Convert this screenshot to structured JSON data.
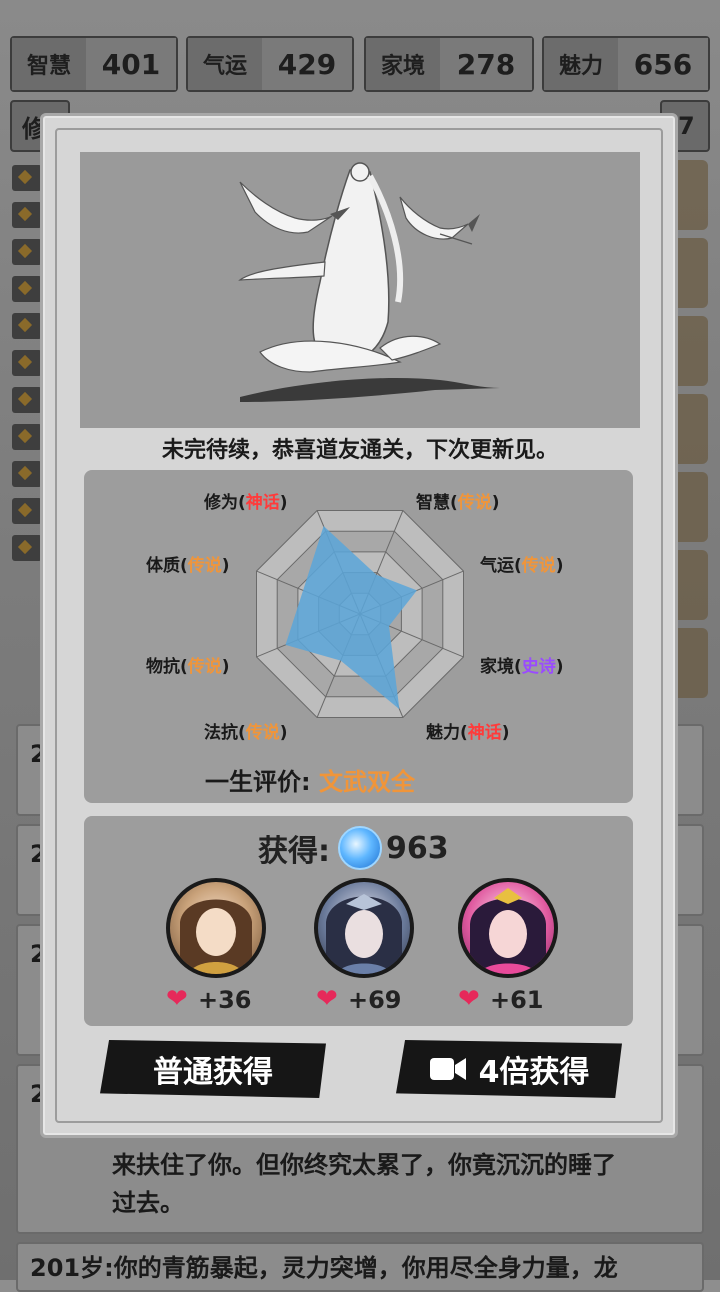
{
  "stats": [
    {
      "name": "智慧",
      "value": "401"
    },
    {
      "name": "气运",
      "value": "429"
    },
    {
      "name": "家境",
      "value": "278"
    },
    {
      "name": "魅力",
      "value": "656"
    }
  ],
  "stats_row2": {
    "left_partial": "修",
    "right_partial": "7"
  },
  "modal": {
    "caption": "未完待续，恭喜道友通关，下次更新见。",
    "radar": {
      "labels": [
        {
          "attr": "修为",
          "tier": "神话",
          "tier_class": "myth"
        },
        {
          "attr": "智慧",
          "tier": "传说",
          "tier_class": "legend"
        },
        {
          "attr": "气运",
          "tier": "传说",
          "tier_class": "legend"
        },
        {
          "attr": "家境",
          "tier": "史诗",
          "tier_class": "epic"
        },
        {
          "attr": "魅力",
          "tier": "神话",
          "tier_class": "myth"
        },
        {
          "attr": "法抗",
          "tier": "传说",
          "tier_class": "legend"
        },
        {
          "attr": "物抗",
          "tier": "传说",
          "tier_class": "legend"
        },
        {
          "attr": "体质",
          "tier": "传说",
          "tier_class": "legend"
        }
      ],
      "values": [
        0.85,
        0.38,
        0.55,
        0.28,
        0.92,
        0.45,
        0.72,
        0.55
      ],
      "fill_color": "#5aa6d9"
    },
    "evaluation_label": "一生评价:",
    "evaluation_value": "文武双全",
    "gain_label": "获得:",
    "gain_value": "963",
    "rewards": [
      {
        "heart_value": "+36"
      },
      {
        "heart_value": "+69"
      },
      {
        "heart_value": "+61"
      }
    ],
    "buttons": {
      "normal": "普通获得",
      "quad": "4倍获得"
    }
  },
  "log": {
    "row_prefixes": [
      "20",
      "2",
      "2",
      "2"
    ],
    "row5_prefix": "201",
    "story_line1": "来扶住了你。但你终究太累了，你竟沉沉的睡了",
    "story_line2": "过去。",
    "last_line": "201岁:你的青筋暴起，灵力突增，你用尽全身力量，龙"
  },
  "colors": {
    "legend": "#f0953a",
    "myth": "#ff3b3b",
    "epic": "#9a4bff"
  }
}
